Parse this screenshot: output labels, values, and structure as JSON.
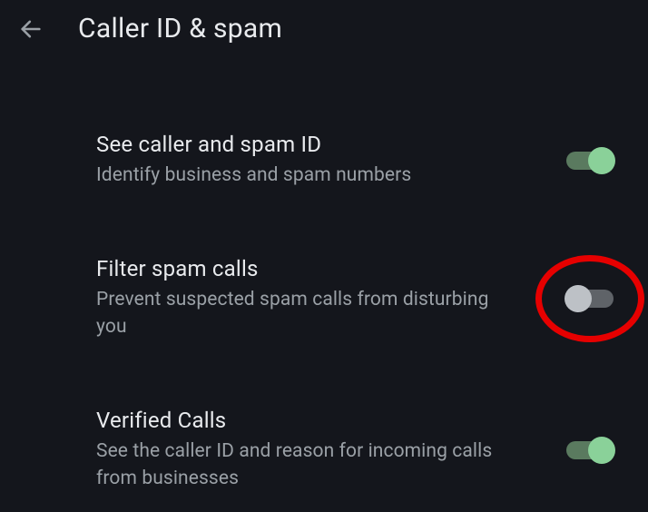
{
  "header": {
    "title": "Caller ID & spam"
  },
  "settings": {
    "caller_id": {
      "title": "See caller and spam ID",
      "description": "Identify business and spam numbers",
      "enabled": true
    },
    "filter_spam": {
      "title": "Filter spam calls",
      "description": "Prevent suspected spam calls from disturbing you",
      "enabled": false,
      "highlighted": true
    },
    "verified_calls": {
      "title": "Verified Calls",
      "description": "See the caller ID and reason for incoming calls from businesses",
      "enabled": true
    }
  }
}
